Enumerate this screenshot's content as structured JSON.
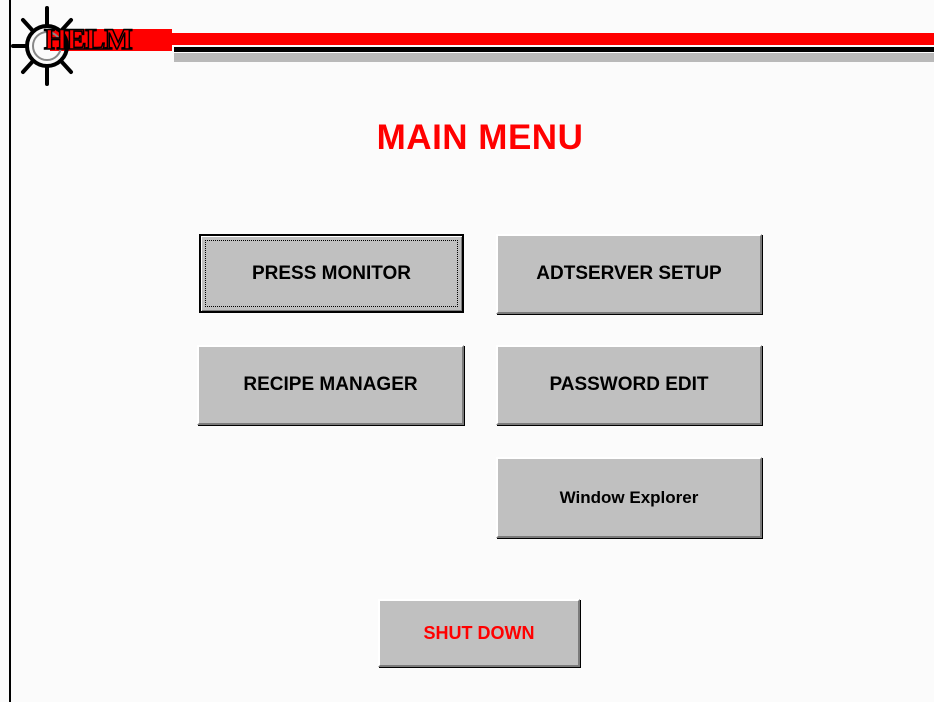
{
  "app": {
    "logo_text": "HELM",
    "title": "MAIN MENU"
  },
  "menu": {
    "press_monitor": "PRESS MONITOR",
    "adtserver_setup": "ADTSERVER SETUP",
    "recipe_manager": "RECIPE MANAGER",
    "password_edit": "PASSWORD EDIT",
    "window_explorer": "Window Explorer",
    "shut_down": "SHUT DOWN"
  },
  "colors": {
    "accent": "#ff0000",
    "button_face": "#c0c0c0",
    "background": "#fbfbfb"
  }
}
